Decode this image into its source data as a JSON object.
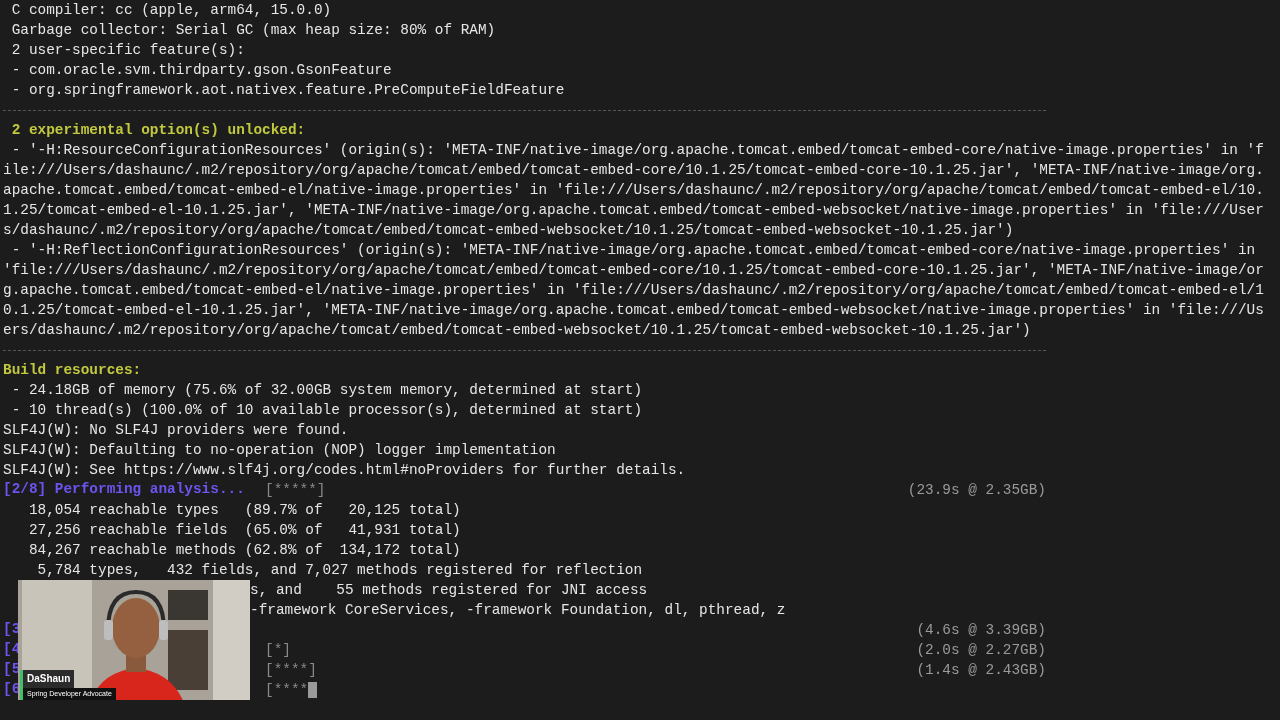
{
  "terminal": {
    "lines": [
      {
        "kind": "plain",
        "text": " C compiler: cc (apple, arm64, 15.0.0)"
      },
      {
        "kind": "plain",
        "text": " Garbage collector: Serial GC (max heap size: 80% of RAM)"
      },
      {
        "kind": "plain",
        "text": " 2 user-specific feature(s):"
      },
      {
        "kind": "plain",
        "text": " - com.oracle.svm.thirdparty.gson.GsonFeature"
      },
      {
        "kind": "plain",
        "text": " - org.springframework.aot.nativex.feature.PreComputeFieldFeature"
      },
      {
        "kind": "divider"
      },
      {
        "kind": "heading",
        "text": " 2 experimental option(s) unlocked:"
      },
      {
        "kind": "plain",
        "text": " - '-H:ResourceConfigurationResources' (origin(s): 'META-INF/native-image/org.apache.tomcat.embed/tomcat-embed-core/native-image.properties' in 'f"
      },
      {
        "kind": "plain",
        "text": "ile:///Users/dashaunc/.m2/repository/org/apache/tomcat/embed/tomcat-embed-core/10.1.25/tomcat-embed-core-10.1.25.jar', 'META-INF/native-image/org."
      },
      {
        "kind": "plain",
        "text": "apache.tomcat.embed/tomcat-embed-el/native-image.properties' in 'file:///Users/dashaunc/.m2/repository/org/apache/tomcat/embed/tomcat-embed-el/10."
      },
      {
        "kind": "plain",
        "text": "1.25/tomcat-embed-el-10.1.25.jar', 'META-INF/native-image/org.apache.tomcat.embed/tomcat-embed-websocket/native-image.properties' in 'file:///User"
      },
      {
        "kind": "plain",
        "text": "s/dashaunc/.m2/repository/org/apache/tomcat/embed/tomcat-embed-websocket/10.1.25/tomcat-embed-websocket-10.1.25.jar')"
      },
      {
        "kind": "plain",
        "text": " - '-H:ReflectionConfigurationResources' (origin(s): 'META-INF/native-image/org.apache.tomcat.embed/tomcat-embed-core/native-image.properties' in"
      },
      {
        "kind": "plain",
        "text": "'file:///Users/dashaunc/.m2/repository/org/apache/tomcat/embed/tomcat-embed-core/10.1.25/tomcat-embed-core-10.1.25.jar', 'META-INF/native-image/or"
      },
      {
        "kind": "plain",
        "text": "g.apache.tomcat.embed/tomcat-embed-el/native-image.properties' in 'file:///Users/dashaunc/.m2/repository/org/apache/tomcat/embed/tomcat-embed-el/1"
      },
      {
        "kind": "plain",
        "text": "0.1.25/tomcat-embed-el-10.1.25.jar', 'META-INF/native-image/org.apache.tomcat.embed/tomcat-embed-websocket/native-image.properties' in 'file:///Us"
      },
      {
        "kind": "plain",
        "text": "ers/dashaunc/.m2/repository/org/apache/tomcat/embed/tomcat-embed-websocket/10.1.25/tomcat-embed-websocket-10.1.25.jar')"
      },
      {
        "kind": "divider"
      },
      {
        "kind": "heading",
        "text": "Build resources:"
      },
      {
        "kind": "plain",
        "text": " - 24.18GB of memory (75.6% of 32.00GB system memory, determined at start)"
      },
      {
        "kind": "plain",
        "text": " - 10 thread(s) (100.0% of 10 available processor(s), determined at start)"
      },
      {
        "kind": "plain",
        "text": "SLF4J(W): No SLF4J providers were found."
      },
      {
        "kind": "plain",
        "text": "SLF4J(W): Defaulting to no-operation (NOP) logger implementation"
      },
      {
        "kind": "plain",
        "text": "SLF4J(W): See https://www.slf4j.org/codes.html#noProviders for further details."
      },
      {
        "kind": "stage",
        "label": "[2/8] Performing analysis...",
        "progress": "[*****]",
        "timing": "(23.9s @ 2.35GB)"
      },
      {
        "kind": "plain",
        "text": "   18,054 reachable types   (89.7% of   20,125 total)"
      },
      {
        "kind": "plain",
        "text": "   27,256 reachable fields  (65.0% of   41,931 total)"
      },
      {
        "kind": "plain",
        "text": "   84,267 reachable methods (62.8% of  134,172 total)"
      },
      {
        "kind": "plain",
        "text": "    5,784 types,   432 fields, and 7,027 methods registered for reflection"
      },
      {
        "kind": "covered",
        "text": "s, and    55 methods registered for JNI access"
      },
      {
        "kind": "covered",
        "text": "-framework CoreServices, -framework Foundation, dl, pthread, z"
      },
      {
        "kind": "covered",
        "label": "[3",
        "timing": "(4.6s @ 3.39GB)"
      },
      {
        "kind": "covered",
        "label": "[4",
        "progress": "[*]",
        "timing": "(2.0s @ 2.27GB)"
      },
      {
        "kind": "covered",
        "label": "[5",
        "progress": "[****]",
        "timing": "(1.4s @ 2.43GB)"
      },
      {
        "kind": "covered",
        "label": "[6",
        "progress": "[****",
        "cursor": true
      }
    ]
  },
  "webcam": {
    "kind": "picture",
    "name": "DaShaun",
    "title": "Spring Developer Advocate"
  }
}
